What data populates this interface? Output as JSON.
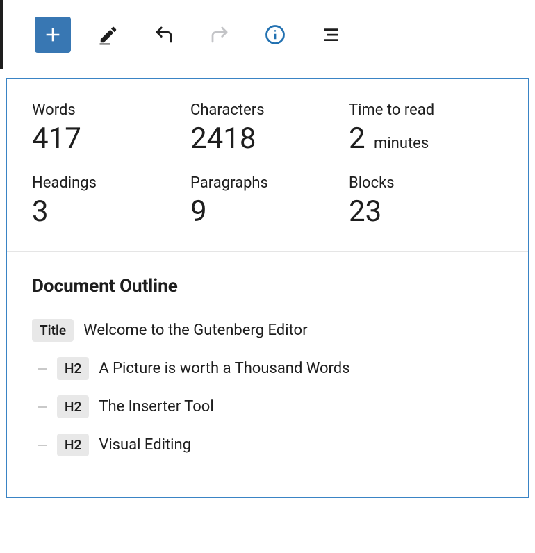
{
  "toolbar": {
    "add": "Add block",
    "edit": "Tools",
    "undo": "Undo",
    "redo": "Redo",
    "info": "Details",
    "outline": "List View"
  },
  "stats": {
    "words": {
      "label": "Words",
      "value": "417"
    },
    "characters": {
      "label": "Characters",
      "value": "2418"
    },
    "time": {
      "label": "Time to read",
      "value": "2",
      "unit": "minutes"
    },
    "headings": {
      "label": "Headings",
      "value": "3"
    },
    "paragraphs": {
      "label": "Paragraphs",
      "value": "9"
    },
    "blocks": {
      "label": "Blocks",
      "value": "23"
    }
  },
  "outline": {
    "title": "Document Outline",
    "items": [
      {
        "badge": "Title",
        "text": "Welcome to the Gutenberg Editor"
      },
      {
        "badge": "H2",
        "text": "A Picture is worth a Thousand Words"
      },
      {
        "badge": "H2",
        "text": "The Inserter Tool"
      },
      {
        "badge": "H2",
        "text": "Visual Editing"
      }
    ]
  }
}
